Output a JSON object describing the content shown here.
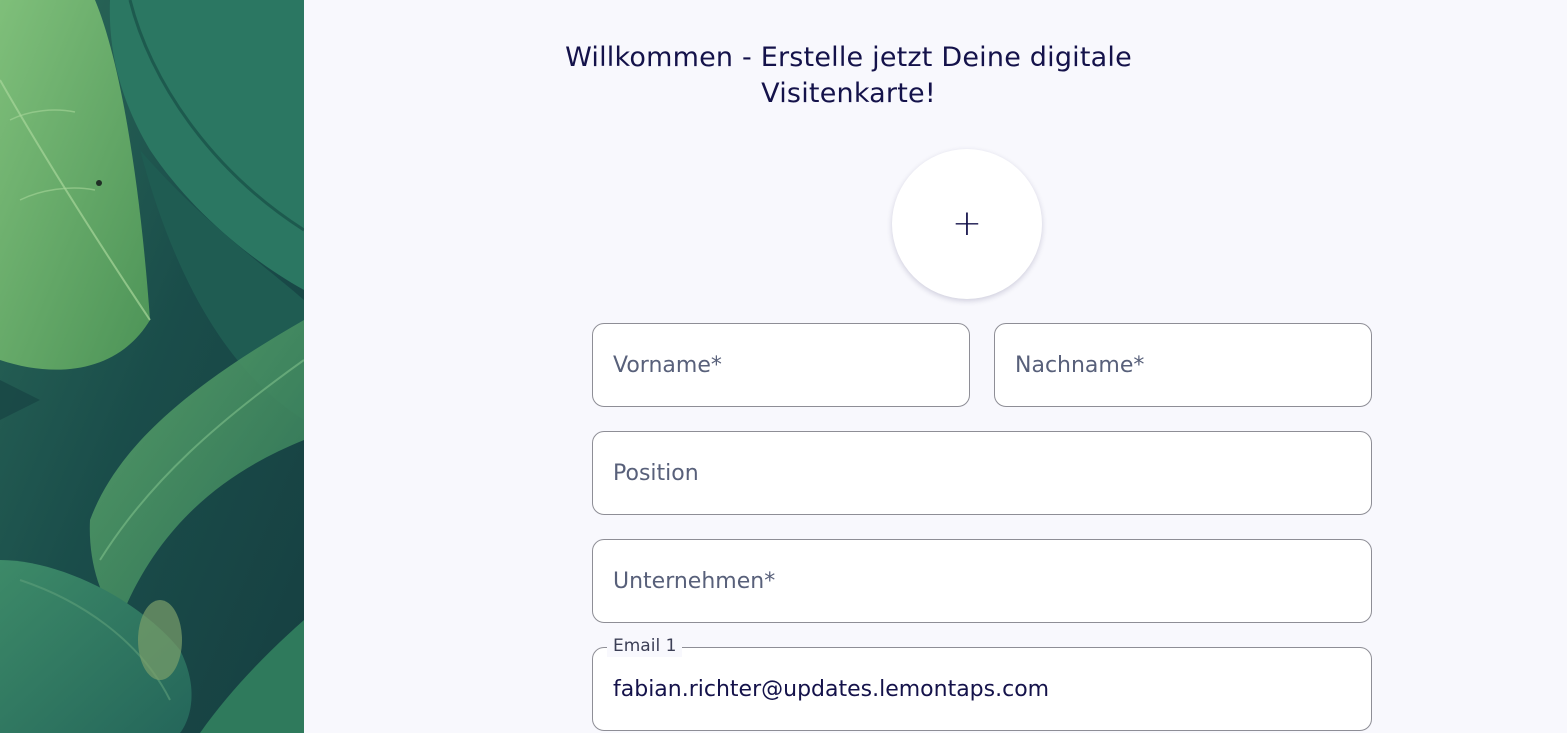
{
  "header": {
    "title": "Willkommen - Erstelle jetzt Deine digitale Visitenkarte!"
  },
  "avatar": {
    "icon": "plus-icon",
    "symbol": "+"
  },
  "form": {
    "first_name": {
      "placeholder": "Vorname*",
      "value": ""
    },
    "last_name": {
      "placeholder": "Nachname*",
      "value": ""
    },
    "position": {
      "placeholder": "Position",
      "value": ""
    },
    "company": {
      "placeholder": "Unternehmen*",
      "value": ""
    },
    "email1": {
      "label": "Email 1",
      "value": "fabian.richter@updates.lemontaps.com"
    }
  },
  "colors": {
    "text_primary": "#14124a",
    "placeholder": "#58607a",
    "border": "#8e8e96",
    "background": "#f8f8fd",
    "leaf_green": "#5a9a5c"
  }
}
